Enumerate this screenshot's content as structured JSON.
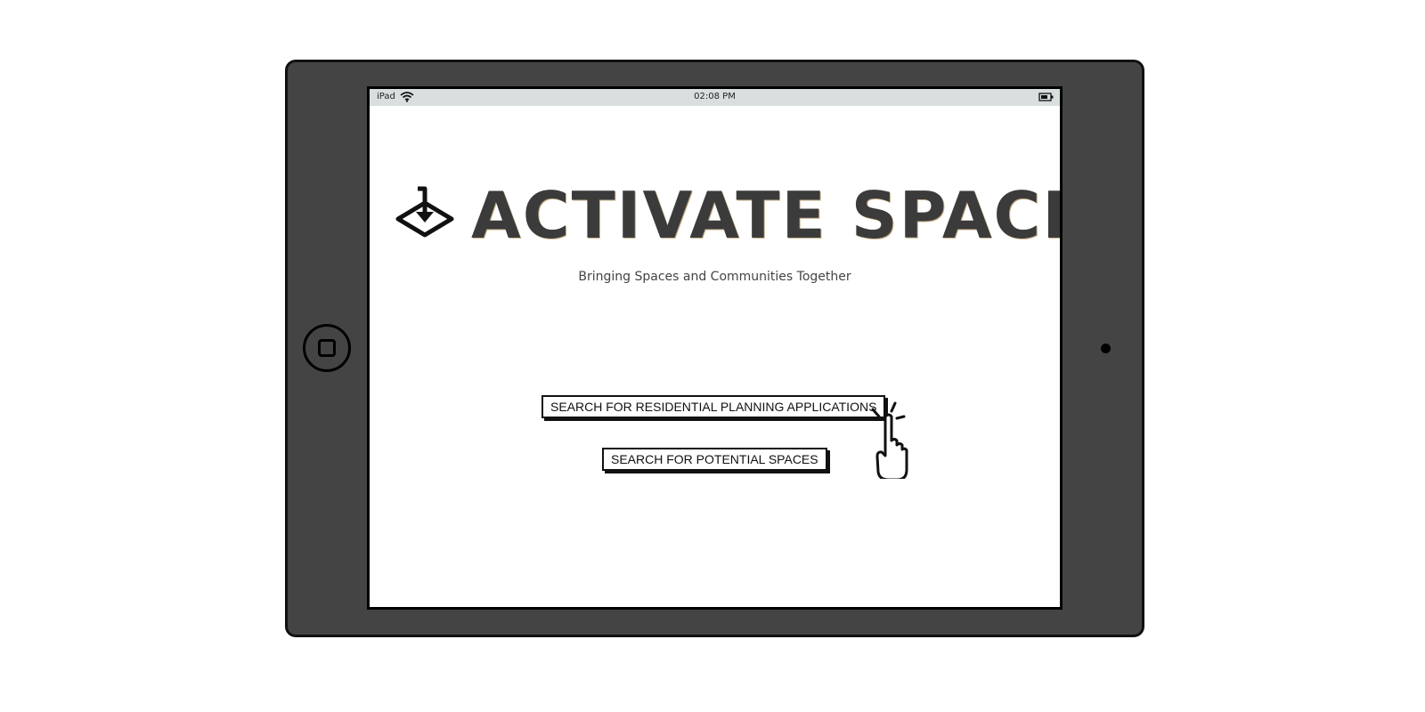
{
  "status_bar": {
    "device": "iPad",
    "time": "02:08 PM",
    "icons": [
      "wifi-icon",
      "battery-icon"
    ]
  },
  "app": {
    "title": "ACTIVATE SPACE",
    "tagline": "Bringing Spaces and Communities Together",
    "logo_icon": "download-diamond-icon"
  },
  "buttons": {
    "residential_label": "SEARCH FOR  RESIDENTIAL PLANNING APPLICATIONS",
    "spaces_label": "SEARCH FOR POTENTIAL SPACES"
  },
  "cursor": {
    "icon": "hand-pointer-click-icon"
  },
  "colors": {
    "device_frame": "#444444",
    "status_bar": "#d9dedf",
    "title_text": "#3b3b3b"
  }
}
